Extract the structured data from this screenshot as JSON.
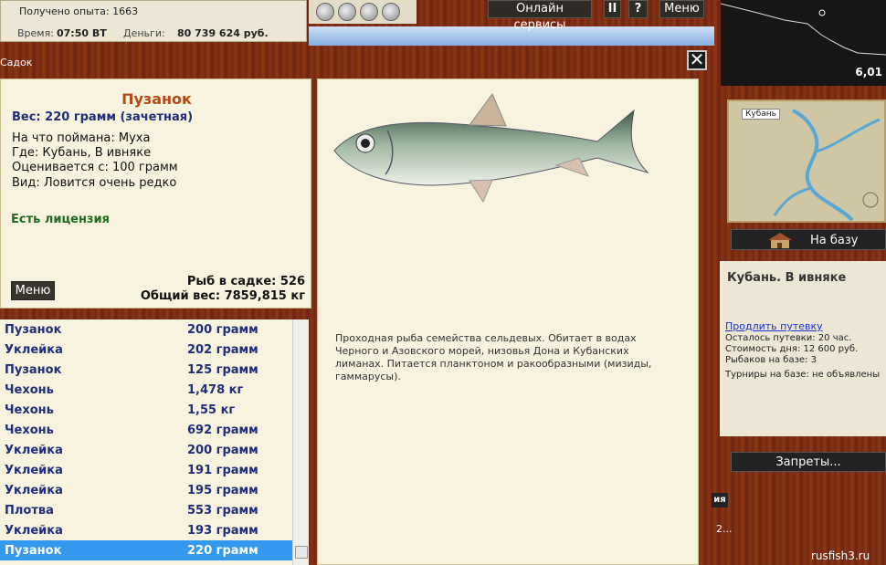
{
  "top_stats": {
    "xp": "Получено опыта: 1663",
    "time_label": "Время:",
    "time_value": "07:50 ВТ",
    "money_label": "Деньги:",
    "money_value": "80 739 624 руб."
  },
  "top_buttons": {
    "online": "Онлайн сервисы",
    "pause": "II",
    "help": "?",
    "menu": "Меню"
  },
  "mini_map": {
    "coord": "6,01"
  },
  "map": {
    "tag": "Кубань"
  },
  "base_button": "На базу",
  "location": {
    "title": "Кубань. В ивняке",
    "extend": "Продлить путевку",
    "info": [
      "Осталось путевки: 20 час.",
      "Стоимость дня: 12 600 руб.",
      "Рыбаков на базе: 3"
    ],
    "tournaments": "Турниры на базе: не объявлены"
  },
  "bans_button": "Запреты...",
  "side_chip": "ия",
  "side_fragment": "2...",
  "watermark": "rusfish3.ru",
  "window": {
    "title": "Садок",
    "close": "✕"
  },
  "fish": {
    "name": "Пузанок",
    "weight": "Вес: 220 грамм (зачетная)",
    "caught_on": "На что поймана: Муха",
    "where": "Где: Кубань, В ивняке",
    "rated_from": "Оценивается с: 100 грамм",
    "kind": "Вид: Ловится очень редко",
    "license": "Есть лицензия",
    "menu": "Меню",
    "count": "Рыб в садке: 526",
    "total": "Общий вес: 7859,815 кг"
  },
  "catch_list": [
    {
      "name": "Пузанок",
      "weight": "200 грамм"
    },
    {
      "name": "Уклейка",
      "weight": "202 грамм"
    },
    {
      "name": "Пузанок",
      "weight": "125 грамм"
    },
    {
      "name": "Чехонь",
      "weight": "1,478 кг"
    },
    {
      "name": "Чехонь",
      "weight": "1,55 кг"
    },
    {
      "name": "Чехонь",
      "weight": "692 грамм"
    },
    {
      "name": "Уклейка",
      "weight": "200 грамм"
    },
    {
      "name": "Уклейка",
      "weight": "191 грамм"
    },
    {
      "name": "Уклейка",
      "weight": "195 грамм"
    },
    {
      "name": "Плотва",
      "weight": "553 грамм"
    },
    {
      "name": "Уклейка",
      "weight": "193 грамм"
    },
    {
      "name": "Пузанок",
      "weight": "220 грамм",
      "selected": true
    }
  ],
  "description": "Проходная рыба семейства сельдевых. Обитает в водах Черного и Азовского морей, низовья Дона и Кубанских лиманах. Питается планктоном и ракообразными (мизиды, гаммарусы).",
  "colors": {
    "wood": "#7a2c12",
    "panel": "#f7f3de",
    "fish_name": "#b44a14",
    "list_text": "#1f2d7a",
    "license": "#1f6b1f",
    "selected_row": "#3399ee",
    "link": "#1a2fcf"
  }
}
